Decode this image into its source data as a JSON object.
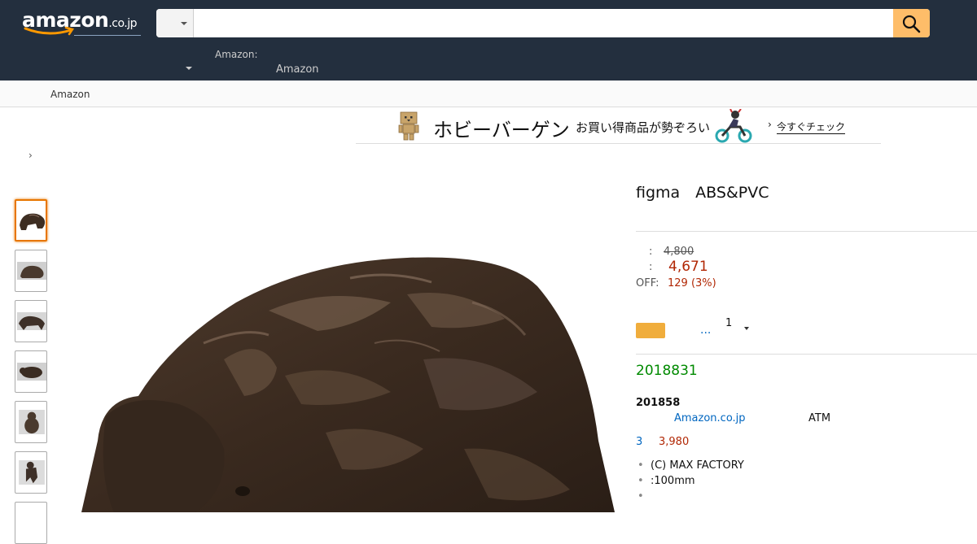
{
  "header": {
    "logo": {
      "name": "amazon",
      "suffix": ".co.jp"
    },
    "search": {
      "value": "",
      "placeholder": ""
    },
    "nav_small": "Amazon:",
    "nav_large": "Amazon"
  },
  "subnav": {
    "link": "Amazon"
  },
  "banner": {
    "title": "ホビーバーゲン",
    "subtitle": "お買い得商品が勢ぞろい",
    "cta": "今すぐチェック"
  },
  "breadcrumb": {
    "separator": "›"
  },
  "thumbnails": {
    "count": 7,
    "active_index": 0
  },
  "product": {
    "title": "figma　ABS&PVC",
    "list_price_label": ":",
    "list_price": "4,800",
    "price_label": ":",
    "price": "4,671",
    "off_label": "OFF:",
    "off_value": "129 (3%)",
    "more": "...",
    "quantity": "1",
    "stock_code": "2018831",
    "bold_code": "201858",
    "seller": "Amazon.co.jp",
    "atm": "ATM",
    "offers_count": "3",
    "offers_price": "3,980",
    "bullets": [
      "(C) MAX FACTORY",
      ":100mm",
      ""
    ]
  },
  "colors": {
    "header_bg": "#232f3e",
    "search_button": "#febd69",
    "price": "#b12704",
    "stock": "#008a00",
    "link": "#0066c0",
    "cart_button": "#f0ad3c",
    "active_thumb": "#e77600"
  },
  "icons": {
    "search": "magnifier-icon",
    "caret": "caret-down-icon"
  }
}
